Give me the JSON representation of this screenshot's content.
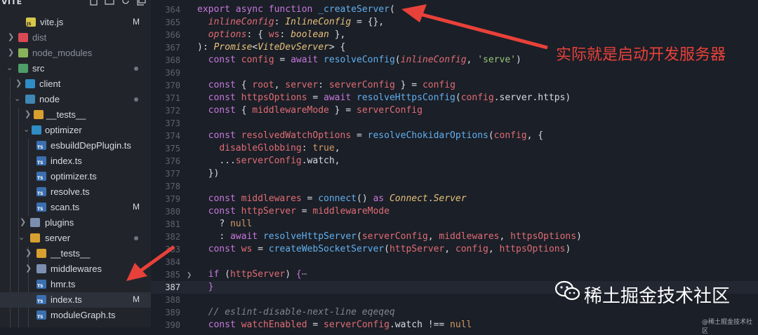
{
  "sidebar": {
    "title": "VITE",
    "items": [
      {
        "label": "vite.js",
        "icon": "js-file-icon",
        "status": "M"
      },
      {
        "label": "dist",
        "icon": "folder-icon",
        "status": ""
      },
      {
        "label": "node_modules",
        "icon": "folder-icon",
        "status": ""
      },
      {
        "label": "src",
        "icon": "folder-icon",
        "status": "dot"
      },
      {
        "label": "client",
        "icon": "folder-icon",
        "status": ""
      },
      {
        "label": "node",
        "icon": "folder-icon",
        "status": "dot"
      },
      {
        "label": "__tests__",
        "icon": "folder-icon",
        "status": ""
      },
      {
        "label": "optimizer",
        "icon": "folder-icon",
        "status": ""
      },
      {
        "label": "esbuildDepPlugin.ts",
        "icon": "ts-file-icon",
        "status": ""
      },
      {
        "label": "index.ts",
        "icon": "ts-file-icon",
        "status": ""
      },
      {
        "label": "optimizer.ts",
        "icon": "ts-file-icon",
        "status": ""
      },
      {
        "label": "resolve.ts",
        "icon": "ts-file-icon",
        "status": ""
      },
      {
        "label": "scan.ts",
        "icon": "ts-file-icon",
        "status": "M"
      },
      {
        "label": "plugins",
        "icon": "folder-icon",
        "status": ""
      },
      {
        "label": "server",
        "icon": "folder-icon",
        "status": "dot"
      },
      {
        "label": "__tests__",
        "icon": "folder-icon",
        "status": ""
      },
      {
        "label": "middlewares",
        "icon": "folder-icon",
        "status": ""
      },
      {
        "label": "hmr.ts",
        "icon": "ts-file-icon",
        "status": ""
      },
      {
        "label": "index.ts",
        "icon": "ts-file-icon",
        "status": "M"
      },
      {
        "label": "moduleGraph.ts",
        "icon": "ts-file-icon",
        "status": ""
      }
    ]
  },
  "editor": {
    "line_numbers": [
      "364",
      "365",
      "366",
      "367",
      "368",
      "369",
      "370",
      "371",
      "372",
      "373",
      "374",
      "375",
      "376",
      "377",
      "378",
      "379",
      "380",
      "381",
      "382",
      "383",
      "384",
      "385",
      "387",
      "388",
      "389",
      "390"
    ],
    "active_line": "387",
    "folded_line": "385"
  },
  "annotations": {
    "callout_text": "实际就是启动开发服务器",
    "watermark_main": "稀土掘金技术社区",
    "watermark_small": "@稀土掘金技术社区"
  },
  "colors": {
    "arrow": "#e8413a",
    "keyword": "#c678dd",
    "function": "#61afef",
    "variable": "#e06c75",
    "type": "#e5c07b",
    "string": "#98c379",
    "boolean": "#d19a66"
  }
}
